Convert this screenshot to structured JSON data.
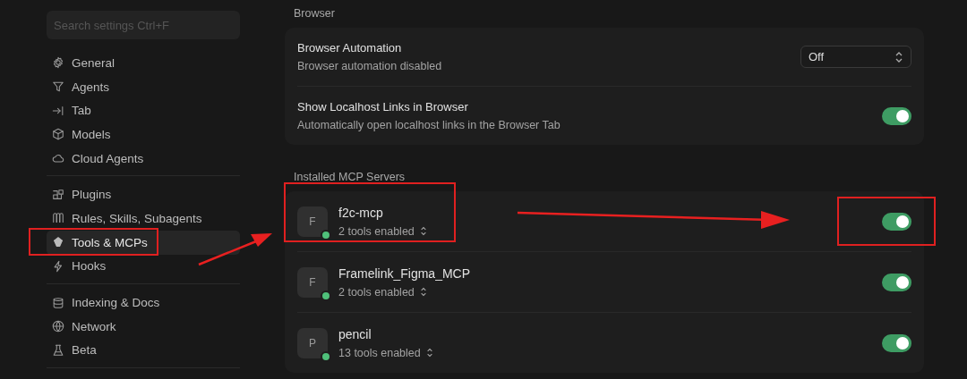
{
  "sidebar": {
    "search": {
      "placeholder": "Search settings Ctrl+F"
    },
    "groups": [
      {
        "items": [
          {
            "label": "General",
            "selected": false
          },
          {
            "label": "Agents",
            "selected": false
          },
          {
            "label": "Tab",
            "selected": false
          },
          {
            "label": "Models",
            "selected": false
          },
          {
            "label": "Cloud Agents",
            "selected": false
          }
        ]
      },
      {
        "items": [
          {
            "label": "Plugins",
            "selected": false
          },
          {
            "label": "Rules, Skills, Subagents",
            "selected": false
          },
          {
            "label": "Tools & MCPs",
            "selected": true
          },
          {
            "label": "Hooks",
            "selected": false
          }
        ]
      },
      {
        "items": [
          {
            "label": "Indexing & Docs",
            "selected": false
          },
          {
            "label": "Network",
            "selected": false
          },
          {
            "label": "Beta",
            "selected": false
          }
        ]
      }
    ]
  },
  "browser": {
    "heading": "Browser",
    "rows": [
      {
        "kind": "select",
        "title": "Browser Automation",
        "description": "Browser automation disabled",
        "value": "Off"
      },
      {
        "kind": "toggle",
        "title": "Show Localhost Links in Browser",
        "description": "Automatically open localhost links in the Browser Tab",
        "on": true
      }
    ]
  },
  "mcp": {
    "heading": "Installed MCP Servers",
    "servers": [
      {
        "initial": "F",
        "name": "f2c-mcp",
        "tools": "2 tools enabled",
        "color": "#4fc07a",
        "on": true
      },
      {
        "initial": "F",
        "name": "Framelink_Figma_MCP",
        "tools": "2 tools enabled",
        "color": "#4fc07a",
        "on": true
      },
      {
        "initial": "P",
        "name": "pencil",
        "tools": "13 tools enabled",
        "color": "#4fc07a",
        "on": true
      }
    ]
  }
}
